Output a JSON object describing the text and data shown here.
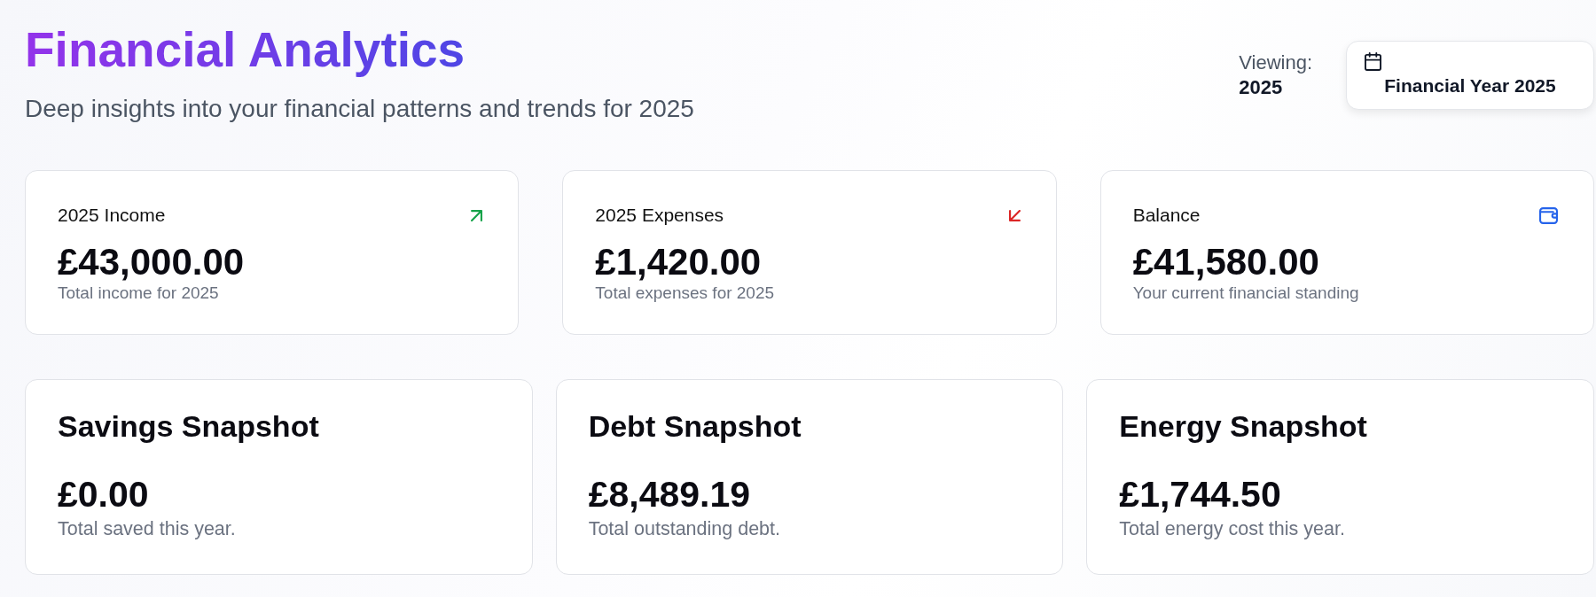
{
  "header": {
    "title": "Financial Analytics",
    "subtitle": "Deep insights into your financial patterns and trends for 2025"
  },
  "viewing": {
    "label": "Viewing:",
    "year": "2025"
  },
  "year_button": {
    "label": "Financial Year 2025"
  },
  "summary_cards": [
    {
      "kind": "income",
      "label": "2025 Income",
      "amount": "£43,000.00",
      "description": "Total income for 2025"
    },
    {
      "kind": "expenses",
      "label": "2025 Expenses",
      "amount": "£1,420.00",
      "description": "Total expenses for 2025"
    },
    {
      "kind": "balance",
      "label": "Balance",
      "amount": "£41,580.00",
      "description": "Your current financial standing"
    }
  ],
  "snapshots": [
    {
      "title": "Savings Snapshot",
      "amount": "£0.00",
      "description": "Total saved this year."
    },
    {
      "title": "Debt Snapshot",
      "amount": "£8,489.19",
      "description": "Total outstanding debt."
    },
    {
      "title": "Energy Snapshot",
      "amount": "£1,744.50",
      "description": "Total energy cost this year."
    }
  ]
}
